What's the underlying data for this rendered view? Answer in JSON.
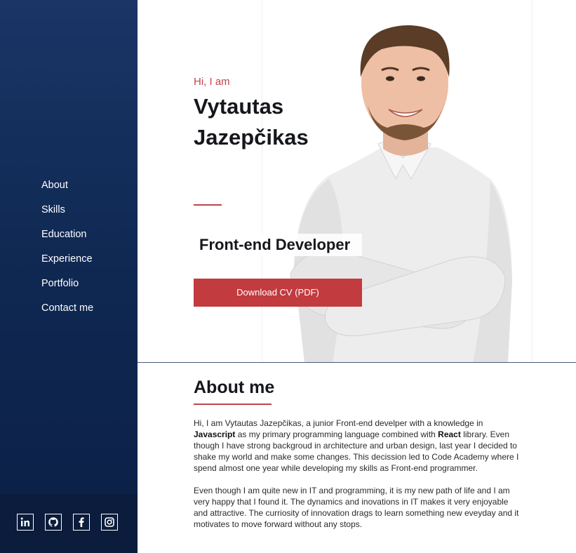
{
  "nav": {
    "items": [
      {
        "label": "About"
      },
      {
        "label": "Skills"
      },
      {
        "label": "Education"
      },
      {
        "label": "Experience"
      },
      {
        "label": "Portfolio"
      },
      {
        "label": "Contact me"
      }
    ]
  },
  "social": [
    {
      "icon": "linkedin-icon"
    },
    {
      "icon": "github-icon"
    },
    {
      "icon": "facebook-icon"
    },
    {
      "icon": "instagram-icon"
    }
  ],
  "hero": {
    "greeting": "Hi, I am",
    "name_line1": "Vytautas",
    "name_line2": "Jazepčikas",
    "role": "Front-end Developer",
    "cv_button": "Download CV (PDF)"
  },
  "about": {
    "title": "About me",
    "p1_a": "Hi, I am Vytautas Jazepčikas, a junior Front-end develper with a knowledge in ",
    "p1_js": "Javascript",
    "p1_b": " as my primary programming language combined with ",
    "p1_react": "React",
    "p1_c": " library. Even though I have strong backgroud in architecture and urban design, last year I decided to shake my world and make some changes. This decission led to Code Academy where I spend almost one year while developing my skills as Front-end programmer.",
    "p2": "Even though I am quite new in IT and programming, it is my new path of life and I am very happy that I found it. The dynamics and inovations in IT makes it very enjoyable and attractive. The curriosity of innovation drags to learn something new eveyday and it motivates to move forward without any stops."
  },
  "colors": {
    "sidebar": "#0f2852",
    "accent": "#c23b3f",
    "text": "#15171c"
  }
}
